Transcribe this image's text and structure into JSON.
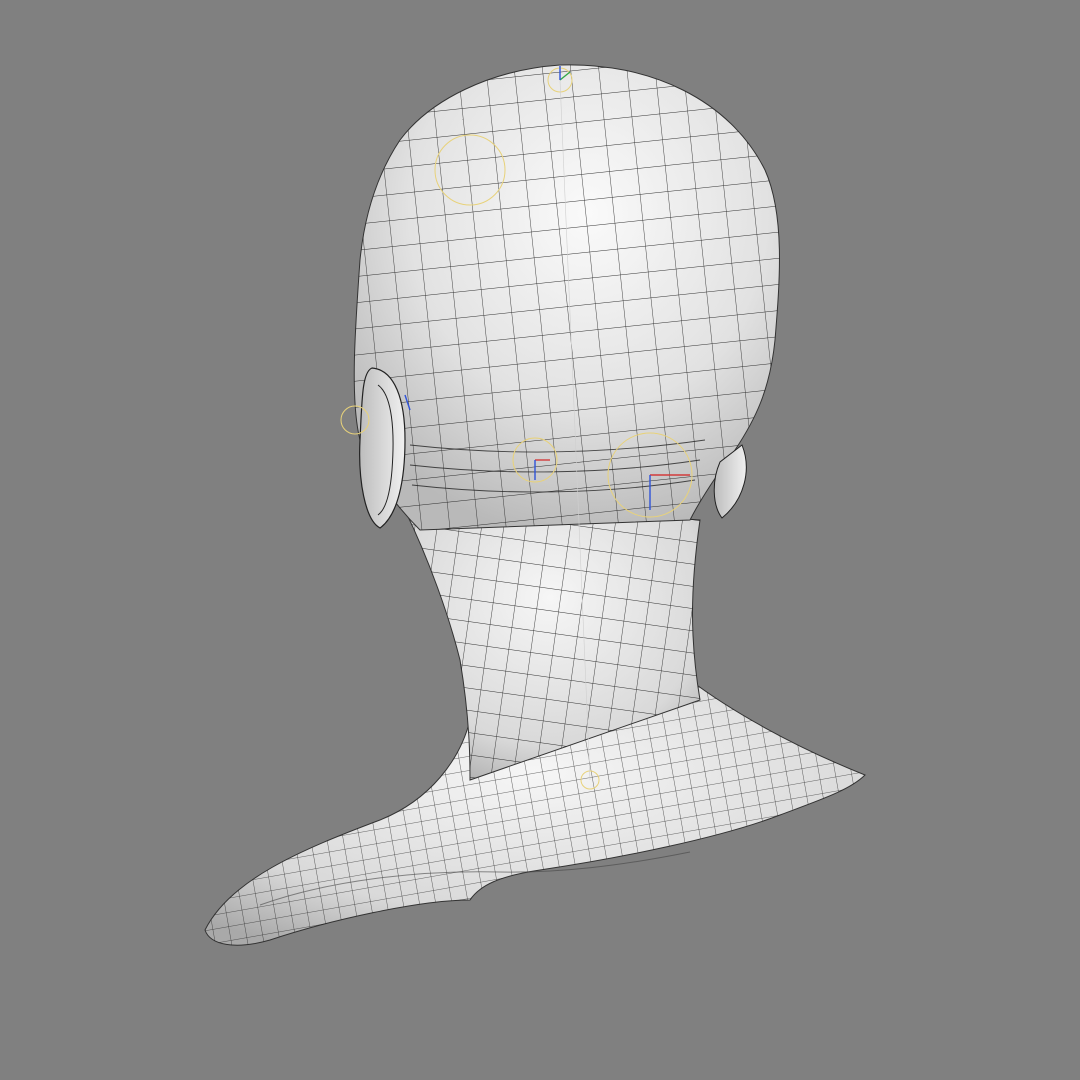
{
  "viewport": {
    "background": "#808080",
    "shading": "smooth-gray-with-wireframe"
  },
  "model": {
    "surface_color": "#e6e6e6",
    "wire_color": "#202020",
    "view": "back-three-quarter"
  },
  "rig": {
    "locator_color": "#e8d27a",
    "axis_colors": {
      "x": "#d23b3b",
      "y": "#33a84a",
      "z": "#2f53d8"
    },
    "locators": [
      "head-top",
      "back-of-head",
      "ear-left",
      "neck-joint",
      "neck-mid",
      "spine-upper"
    ]
  }
}
